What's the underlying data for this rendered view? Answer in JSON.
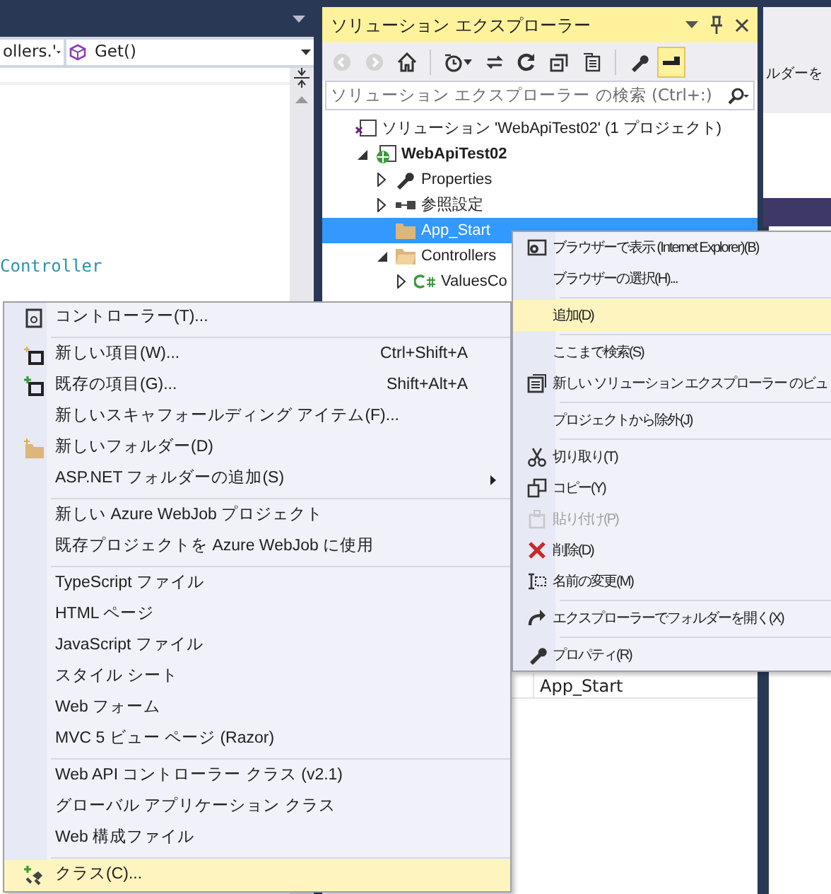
{
  "editor": {
    "type_dropdown": "ollers.'",
    "member_dropdown": "Get()",
    "code_lines": [
      "Controller"
    ]
  },
  "solution_explorer": {
    "title": "ソリューション エクスプローラー",
    "toolbar": [
      {
        "kind": "back",
        "disabled": true,
        "on": false
      },
      {
        "kind": "forward",
        "disabled": true,
        "on": false
      },
      {
        "kind": "home",
        "disabled": false,
        "on": false
      },
      {
        "kind": "separator"
      },
      {
        "kind": "history",
        "disabled": false,
        "on": false
      },
      {
        "kind": "sync",
        "disabled": false,
        "on": false
      },
      {
        "kind": "refresh",
        "disabled": false,
        "on": false
      },
      {
        "kind": "collapse",
        "disabled": false,
        "on": false
      },
      {
        "kind": "show_all",
        "disabled": false,
        "on": false
      },
      {
        "kind": "separator"
      },
      {
        "kind": "properties",
        "disabled": false,
        "on": false
      },
      {
        "kind": "preview",
        "disabled": false,
        "on": true
      }
    ],
    "search": {
      "placeholder": "ソリューション エクスプローラー の検索 (Ctrl+:)"
    },
    "tree": [
      {
        "kind": "solution",
        "label": "ソリューション 'WebApiTest02' (1 プロジェクト)",
        "selected": false,
        "children": [
          {
            "kind": "project",
            "label": "WebApiTest02",
            "selected": false,
            "expanded": true,
            "children": [
              {
                "kind": "properties",
                "label": "Properties",
                "selected": false,
                "expanded": false
              },
              {
                "kind": "references",
                "label": "参照設定",
                "selected": false,
                "expanded": false
              },
              {
                "kind": "folder",
                "label": "App_Start",
                "selected": true
              },
              {
                "kind": "folder_open",
                "label": "Controllers",
                "selected": false,
                "expanded": true,
                "children": [
                  {
                    "kind": "csharp",
                    "label": "ValuesCo",
                    "selected": false,
                    "expanded": false
                  }
                ]
              }
            ]
          }
        ]
      }
    ]
  },
  "properties": {
    "rows": [
      {
        "value": "App_Start"
      }
    ]
  },
  "background_popup": {
    "text": "ルダーを"
  },
  "add_menu": [
    {
      "kind": "controller",
      "label": "コントローラー(T)...",
      "selected": false
    },
    {
      "kind": "separator"
    },
    {
      "kind": "new_item",
      "label": "新しい項目(W)...",
      "shortcut": "Ctrl+Shift+A",
      "selected": false
    },
    {
      "kind": "existing_item",
      "label": "既存の項目(G)...",
      "shortcut": "Shift+Alt+A",
      "selected": false
    },
    {
      "kind": "item",
      "label": "新しいスキャフォールディング アイテム(F)...",
      "selected": false
    },
    {
      "kind": "new_folder",
      "label": "新しいフォルダー(D)",
      "selected": false
    },
    {
      "kind": "item",
      "label": "ASP.NET フォルダーの追加(S)",
      "submenu": true,
      "selected": false
    },
    {
      "kind": "separator"
    },
    {
      "kind": "item",
      "label": "新しい Azure WebJob プロジェクト",
      "selected": false
    },
    {
      "kind": "item",
      "label": "既存プロジェクトを Azure WebJob に使用",
      "selected": false
    },
    {
      "kind": "separator"
    },
    {
      "kind": "item",
      "label": "TypeScript ファイル",
      "selected": false
    },
    {
      "kind": "item",
      "label": "HTML ページ",
      "selected": false
    },
    {
      "kind": "item",
      "label": "JavaScript ファイル",
      "selected": false
    },
    {
      "kind": "item",
      "label": "スタイル シート",
      "selected": false
    },
    {
      "kind": "item",
      "label": "Web フォーム",
      "selected": false
    },
    {
      "kind": "item",
      "label": "MVC 5 ビュー ページ (Razor)",
      "selected": false
    },
    {
      "kind": "separator"
    },
    {
      "kind": "item",
      "label": "Web API コントローラー クラス (v2.1)",
      "selected": false
    },
    {
      "kind": "item",
      "label": "グローバル アプリケーション クラス",
      "selected": false
    },
    {
      "kind": "item",
      "label": "Web 構成ファイル",
      "selected": false
    },
    {
      "kind": "separator"
    },
    {
      "kind": "class",
      "label": "クラス(C)...",
      "selected": true
    }
  ],
  "context_menu": [
    {
      "kind": "browser",
      "label": "ブラウザーで表示 (Internet Explorer)(B)",
      "selected": false,
      "disabled": false
    },
    {
      "kind": "item",
      "label": "ブラウザーの選択(H)...",
      "selected": false,
      "disabled": false
    },
    {
      "kind": "separator"
    },
    {
      "kind": "item",
      "label": "追加(D)",
      "selected": true,
      "disabled": false
    },
    {
      "kind": "separator"
    },
    {
      "kind": "item",
      "label": "ここまで検索(S)",
      "selected": false,
      "disabled": false
    },
    {
      "kind": "new_view",
      "label": "新しい ソリューション エクスプローラー のビュ",
      "selected": false,
      "disabled": false
    },
    {
      "kind": "separator"
    },
    {
      "kind": "item",
      "label": "プロジェクトから除外(J)",
      "selected": false,
      "disabled": false
    },
    {
      "kind": "separator"
    },
    {
      "kind": "cut",
      "label": "切り取り(T)",
      "selected": false,
      "disabled": false
    },
    {
      "kind": "copy",
      "label": "コピー(Y)",
      "selected": false,
      "disabled": false
    },
    {
      "kind": "paste",
      "label": "貼り付け(P)",
      "selected": false,
      "disabled": true
    },
    {
      "kind": "delete",
      "label": "削除(D)",
      "selected": false,
      "disabled": false
    },
    {
      "kind": "rename",
      "label": "名前の変更(M)",
      "selected": false,
      "disabled": false
    },
    {
      "kind": "separator"
    },
    {
      "kind": "open_folder",
      "label": "エクスプローラーでフォルダーを開く(X)",
      "selected": false,
      "disabled": false
    },
    {
      "kind": "separator"
    },
    {
      "kind": "properties",
      "label": "プロパティ(R)",
      "selected": false,
      "disabled": false
    }
  ]
}
